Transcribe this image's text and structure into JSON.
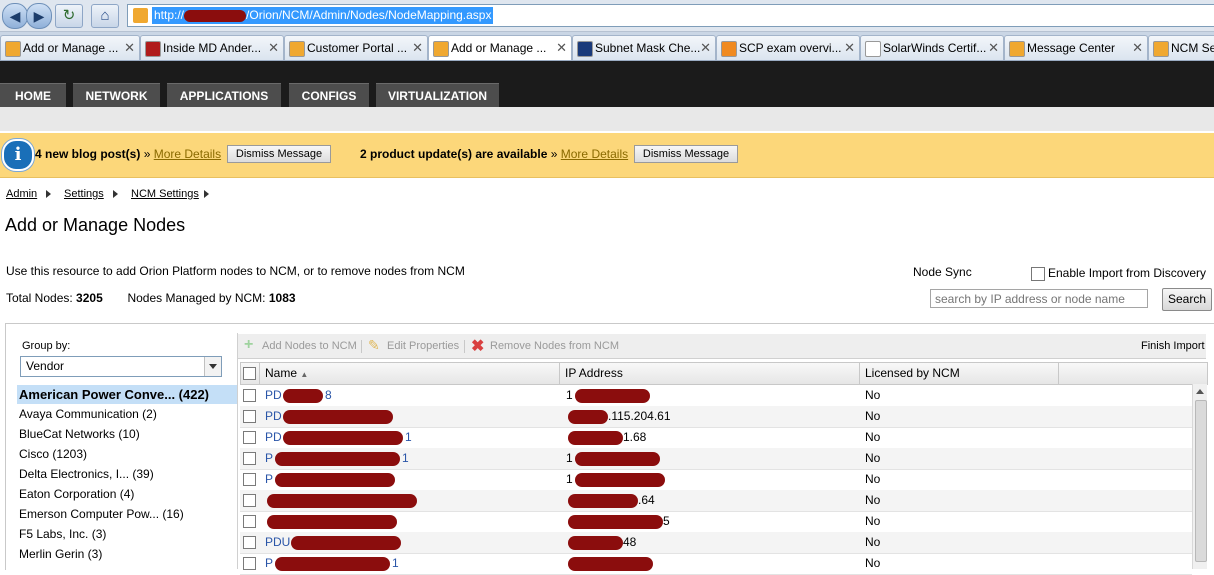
{
  "browser": {
    "url_prefix": "http://",
    "url_suffix": "/Orion/NCM/Admin/Nodes/NodeMapping.aspx",
    "tabs": [
      {
        "label": "Add or Manage ...",
        "color": "#f0a830"
      },
      {
        "label": "Inside MD Ander...",
        "color": "#b01c1c"
      },
      {
        "label": "Customer Portal ...",
        "color": "#f0a830"
      },
      {
        "label": "Add or Manage ...",
        "color": "#f0a830"
      },
      {
        "label": "Subnet Mask Che...",
        "color": "#1a3a7a"
      },
      {
        "label": "SCP exam overvi...",
        "color": "#f08a20"
      },
      {
        "label": "SolarWinds Certif...",
        "color": "#ffffff"
      },
      {
        "label": "Message Center",
        "color": "#f0a830"
      },
      {
        "label": "NCM Se",
        "color": "#f0a830"
      }
    ],
    "close_glyph": "✕"
  },
  "nav": {
    "items": [
      "HOME",
      "NETWORK",
      "APPLICATIONS",
      "CONFIGS",
      "VIRTUALIZATION"
    ]
  },
  "messages": {
    "info_glyph": "i",
    "blog": "4 new blog post(s)",
    "updates": "2 product update(s) are available",
    "raquo": "»",
    "more_details": "More Details",
    "dismiss": "Dismiss Message"
  },
  "breadcrumb": [
    "Admin",
    "Settings",
    "NCM Settings"
  ],
  "page": {
    "title": "Add or Manage Nodes",
    "description": "Use this resource to add Orion Platform nodes to NCM, or to remove nodes from NCM",
    "total_label": "Total Nodes:",
    "total_value": "3205",
    "managed_label": "Nodes Managed by NCM:",
    "managed_value": "1083",
    "node_sync_label": "Node Sync",
    "enable_import_label": "Enable Import from Discovery",
    "search_placeholder": "search by IP address or node name",
    "search_button": "Search"
  },
  "groupby": {
    "label": "Group by:",
    "selected": "Vendor",
    "items": [
      "American Power Conve... (422)",
      "Avaya Communication (2)",
      "BlueCat Networks (10)",
      "Cisco (1203)",
      "Delta Electronics, I... (39)",
      "Eaton Corporation (4)",
      "Emerson Computer Pow... (16)",
      "F5 Labs, Inc. (3)",
      "Merlin Gerin (3)"
    ]
  },
  "toolbar": {
    "add": "Add Nodes to NCM",
    "edit": "Edit Properties",
    "remove": "Remove Nodes from NCM",
    "finish": "Finish Import"
  },
  "grid": {
    "columns": [
      "Name",
      "IP Address",
      "Licensed by NCM"
    ],
    "sort_glyph": "▲",
    "rows": [
      {
        "name": "PD",
        "name_tail": "8",
        "ip": "1",
        "ip_tail": "",
        "licensed": "No"
      },
      {
        "name": "PD",
        "name_tail": "",
        "ip": "",
        "ip_tail": ".115.204.61",
        "licensed": "No"
      },
      {
        "name": "PD",
        "name_tail": "1",
        "ip": "",
        "ip_tail": "1.68",
        "licensed": "No"
      },
      {
        "name": "P",
        "name_tail": "1",
        "ip": "1",
        "ip_tail": "",
        "licensed": "No"
      },
      {
        "name": "P",
        "name_tail": "",
        "ip": "1",
        "ip_tail": "",
        "licensed": "No"
      },
      {
        "name": "",
        "name_tail": "",
        "ip": "",
        "ip_tail": ".64",
        "licensed": "No"
      },
      {
        "name": "",
        "name_tail": "",
        "ip": "",
        "ip_tail": "5",
        "licensed": "No"
      },
      {
        "name": "PDU",
        "name_tail": "",
        "ip": "",
        "ip_tail": "48",
        "licensed": "No"
      },
      {
        "name": "P",
        "name_tail": "1",
        "ip": "",
        "ip_tail": "",
        "licensed": "No"
      }
    ]
  }
}
